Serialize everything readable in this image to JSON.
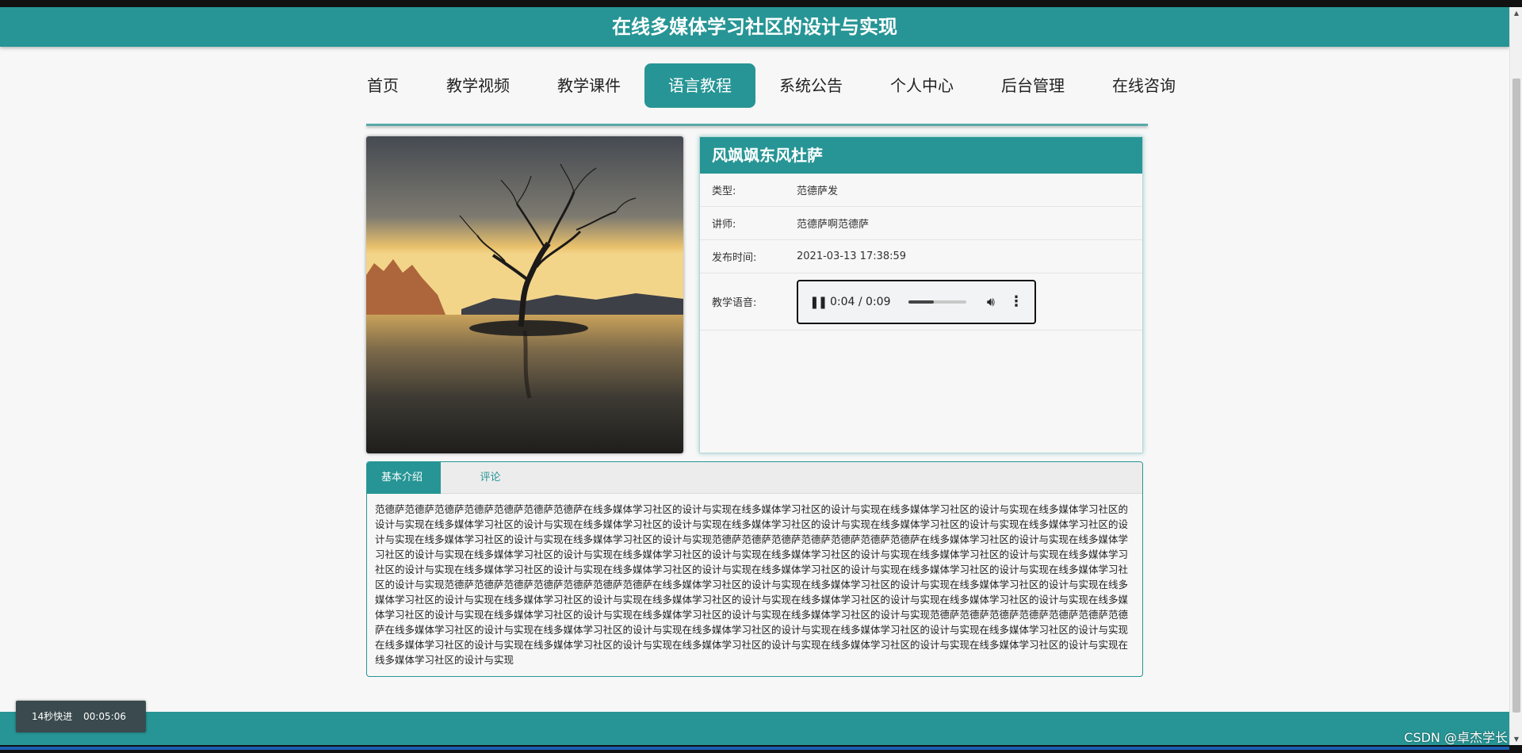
{
  "header": {
    "title": "在线多媒体学习社区的设计与实现"
  },
  "nav": {
    "items": [
      {
        "label": "首页",
        "active": false
      },
      {
        "label": "教学视频",
        "active": false
      },
      {
        "label": "教学课件",
        "active": false
      },
      {
        "label": "语言教程",
        "active": true
      },
      {
        "label": "系统公告",
        "active": false
      },
      {
        "label": "个人中心",
        "active": false
      },
      {
        "label": "后台管理",
        "active": false
      },
      {
        "label": "在线咨询",
        "active": false
      }
    ]
  },
  "detail": {
    "title": "风飒飒东风杜萨",
    "type_label": "类型:",
    "type_value": "范德萨发",
    "teacher_label": "讲师:",
    "teacher_value": "范德萨啊范德萨",
    "date_label": "发布时间:",
    "date_value": "2021-03-13 17:38:59",
    "audio_label": "教学语音:"
  },
  "audio": {
    "time": "0:04 / 0:09",
    "progress": 0.44
  },
  "tabs": {
    "items": [
      {
        "label": "基本介绍",
        "active": true
      },
      {
        "label": "评论",
        "active": false
      }
    ],
    "content": "范德萨范德萨范德萨范德萨范德萨范德萨范德萨在线多媒体学习社区的设计与实现在线多媒体学习社区的设计与实现在线多媒体学习社区的设计与实现在线多媒体学习社区的设计与实现在线多媒体学习社区的设计与实现在线多媒体学习社区的设计与实现在线多媒体学习社区的设计与实现在线多媒体学习社区的设计与实现在线多媒体学习社区的设计与实现在线多媒体学习社区的设计与实现在线多媒体学习社区的设计与实现范德萨范德萨范德萨范德萨范德萨范德萨范德萨在线多媒体学习社区的设计与实现在线多媒体学习社区的设计与实现在线多媒体学习社区的设计与实现在线多媒体学习社区的设计与实现在线多媒体学习社区的设计与实现在线多媒体学习社区的设计与实现在线多媒体学习社区的设计与实现在线多媒体学习社区的设计与实现在线多媒体学习社区的设计与实现在线多媒体学习社区的设计与实现在线多媒体学习社区的设计与实现在线多媒体学习社区的设计与实现范德萨范德萨范德萨范德萨范德萨范德萨范德萨在线多媒体学习社区的设计与实现在线多媒体学习社区的设计与实现在线多媒体学习社区的设计与实现在线多媒体学习社区的设计与实现在线多媒体学习社区的设计与实现在线多媒体学习社区的设计与实现在线多媒体学习社区的设计与实现在线多媒体学习社区的设计与实现在线多媒体学习社区的设计与实现在线多媒体学习社区的设计与实现在线多媒体学习社区的设计与实现在线多媒体学习社区的设计与实现范德萨范德萨范德萨范德萨范德萨范德萨范德萨在线多媒体学习社区的设计与实现在线多媒体学习社区的设计与实现在线多媒体学习社区的设计与实现在线多媒体学习社区的设计与实现在线多媒体学习社区的设计与实现在线多媒体学习社区的设计与实现在线多媒体学习社区的设计与实现在线多媒体学习社区的设计与实现在线多媒体学习社区的设计与实现在线多媒体学习社区的设计与实现在线多媒体学习社区的设计与实现"
  },
  "overlay": {
    "text": "14秒快进 00:05:06"
  },
  "watermark": {
    "text": "CSDN @卓杰学长"
  },
  "colors": {
    "accent": "#279595",
    "background": "#f7f7f7"
  },
  "icons": {
    "pause": "pause-icon",
    "volume": "volume-icon",
    "more": "more-vertical-icon"
  }
}
